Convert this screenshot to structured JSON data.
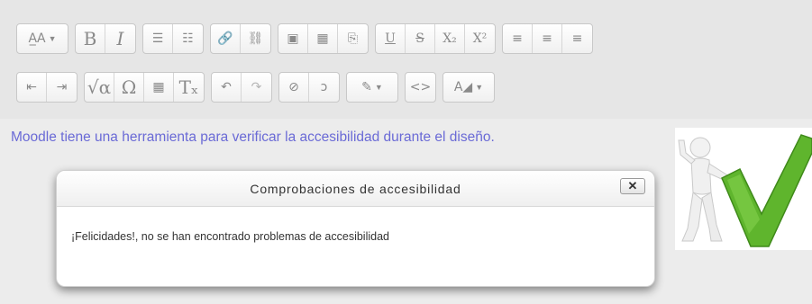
{
  "toolbar": {
    "row1": [
      {
        "group": "text-style",
        "buttons": [
          {
            "name": "text-style-menu-button",
            "glyph": "A̲A",
            "icon": "font-style-icon",
            "has_menu": true
          }
        ]
      },
      {
        "group": "basic",
        "buttons": [
          {
            "name": "bold-button",
            "glyph": "B",
            "icon": "bold-icon"
          },
          {
            "name": "italic-button",
            "glyph": "I",
            "icon": "italic-icon"
          }
        ]
      },
      {
        "group": "lists",
        "buttons": [
          {
            "name": "unordered-list-button",
            "glyph": "☰",
            "icon": "bullet-list-icon"
          },
          {
            "name": "ordered-list-button",
            "glyph": "☷",
            "icon": "numbered-list-icon"
          }
        ]
      },
      {
        "group": "links",
        "buttons": [
          {
            "name": "link-button",
            "glyph": "🔗",
            "icon": "link-icon"
          },
          {
            "name": "unlink-button",
            "glyph": "⛓",
            "icon": "unlink-icon"
          }
        ]
      },
      {
        "group": "media",
        "buttons": [
          {
            "name": "insert-image-button",
            "glyph": "▣",
            "icon": "image-icon"
          },
          {
            "name": "insert-media-button",
            "glyph": "▦",
            "icon": "film-icon"
          },
          {
            "name": "manage-files-button",
            "glyph": "⎘",
            "icon": "files-icon"
          }
        ]
      },
      {
        "group": "style",
        "buttons": [
          {
            "name": "underline-button",
            "glyph": "U",
            "icon": "underline-icon"
          },
          {
            "name": "strikethrough-button",
            "glyph": "S",
            "icon": "strikethrough-icon"
          },
          {
            "name": "subscript-button",
            "glyph": "X₂",
            "icon": "subscript-icon"
          },
          {
            "name": "superscript-button",
            "glyph": "X²",
            "icon": "superscript-icon"
          }
        ]
      },
      {
        "group": "align",
        "buttons": [
          {
            "name": "align-left-button",
            "glyph": "≡",
            "icon": "align-left-icon"
          },
          {
            "name": "align-center-button",
            "glyph": "≡",
            "icon": "align-center-icon"
          },
          {
            "name": "align-right-button",
            "glyph": "≡",
            "icon": "align-right-icon"
          }
        ]
      }
    ],
    "row2": [
      {
        "group": "indent",
        "buttons": [
          {
            "name": "outdent-button",
            "glyph": "⇤",
            "icon": "outdent-icon"
          },
          {
            "name": "indent-button",
            "glyph": "⇥",
            "icon": "indent-icon"
          }
        ]
      },
      {
        "group": "insert",
        "buttons": [
          {
            "name": "equation-button",
            "glyph": "√α",
            "icon": "equation-icon"
          },
          {
            "name": "special-character-button",
            "glyph": "Ω",
            "icon": "omega-icon"
          },
          {
            "name": "table-button",
            "glyph": "▦",
            "icon": "table-icon"
          },
          {
            "name": "clear-formatting-button",
            "glyph": "Tₓ",
            "icon": "clear-formatting-icon"
          }
        ]
      },
      {
        "group": "history",
        "buttons": [
          {
            "name": "undo-button",
            "glyph": "↶",
            "icon": "undo-icon"
          },
          {
            "name": "redo-button",
            "glyph": "↷",
            "icon": "redo-icon",
            "disabled": true
          }
        ]
      },
      {
        "group": "accessibility",
        "buttons": [
          {
            "name": "accessibility-checker-button",
            "glyph": "⊘",
            "icon": "eye-slash-icon"
          },
          {
            "name": "screenreader-helper-button",
            "glyph": "ↄ",
            "icon": "ear-icon"
          }
        ]
      },
      {
        "group": "color",
        "buttons": [
          {
            "name": "background-color-menu-button",
            "glyph": "✎",
            "icon": "paint-brush-icon",
            "has_menu": true
          }
        ]
      },
      {
        "group": "html",
        "buttons": [
          {
            "name": "html-source-button",
            "glyph": "<>",
            "icon": "code-icon"
          }
        ]
      },
      {
        "group": "font-color",
        "buttons": [
          {
            "name": "font-color-menu-button",
            "glyph": "A◢",
            "icon": "font-color-icon",
            "has_menu": true
          }
        ]
      }
    ]
  },
  "editor": {
    "paragraph": "Moodle tiene una herramienta para verificar la accesibilidad durante el diseño."
  },
  "dialog": {
    "title": "Comprobaciones de accesibilidad",
    "close_label": "✕",
    "message": "¡Felicidades!, no se han encontrado problemas de accesibilidad"
  },
  "colors": {
    "paragraph_text": "#6a6ad6",
    "checkmark": "#5fb52d",
    "toolbar_bg": "#e6e6e6"
  }
}
